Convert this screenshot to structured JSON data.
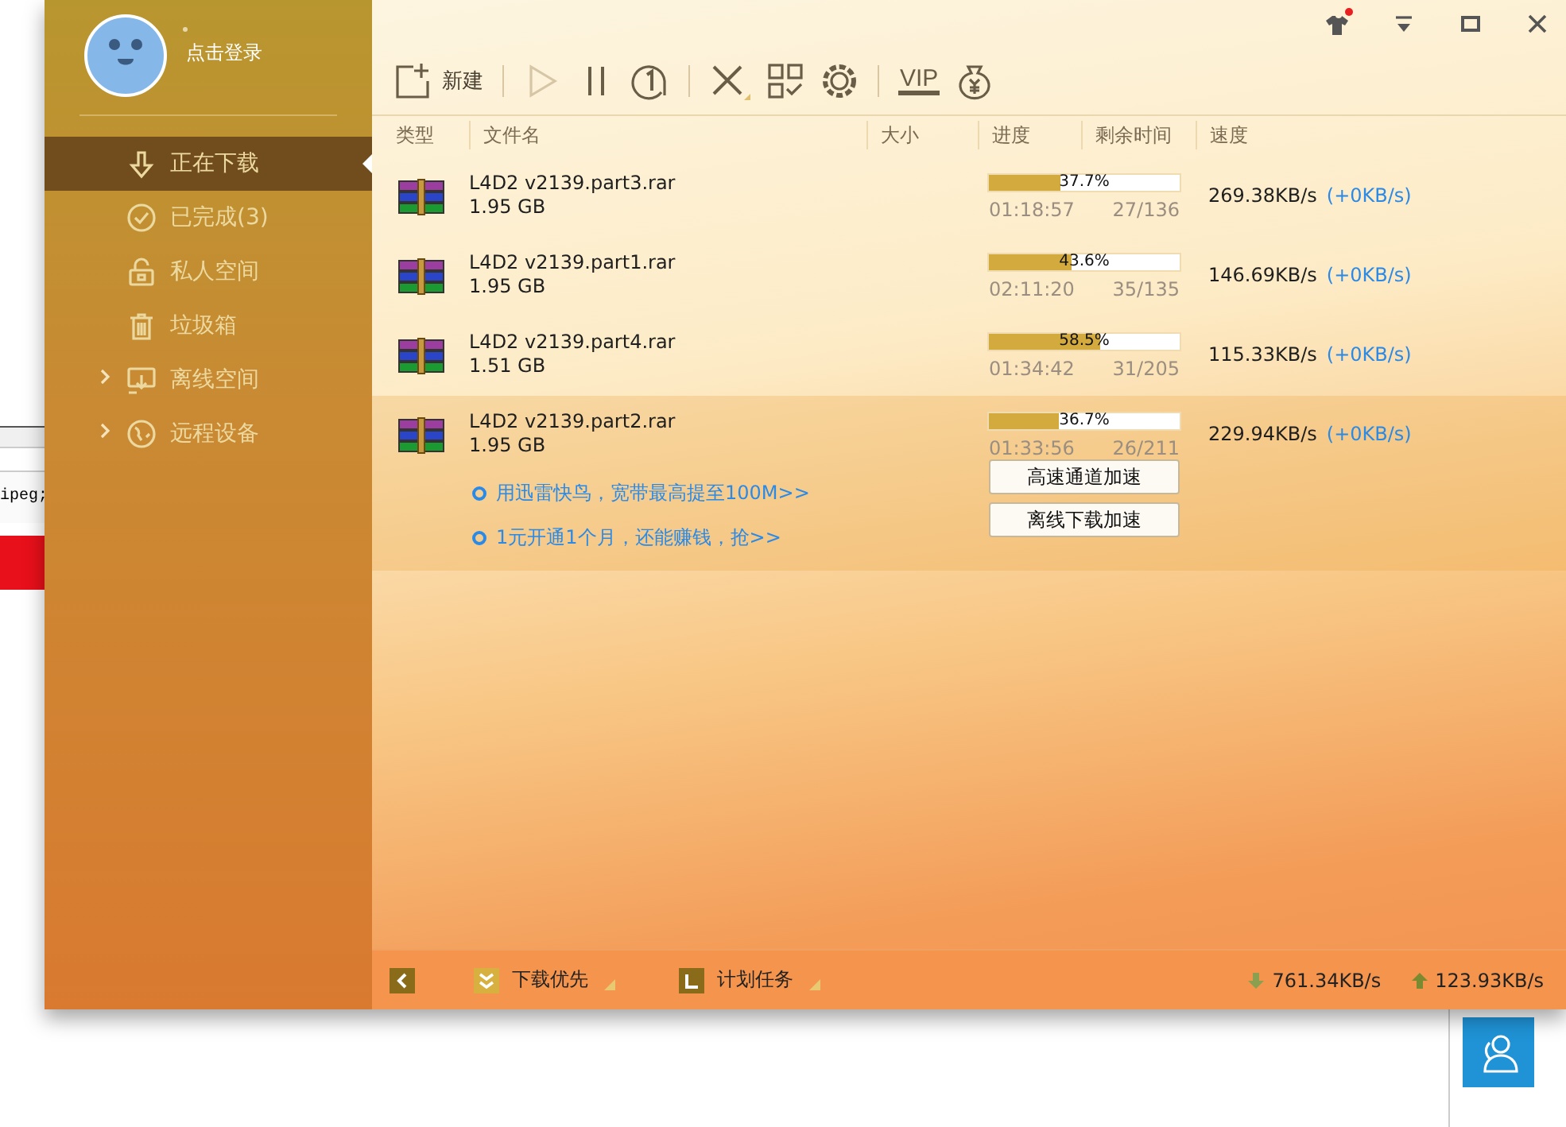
{
  "background": {
    "fragment_text": "ipeg;"
  },
  "sidebar": {
    "login_label": "点击登录",
    "items": [
      {
        "label": "正在下载",
        "selected": true,
        "kind": "plain"
      },
      {
        "label": "已完成(3)",
        "selected": false,
        "kind": "plain"
      },
      {
        "label": "私人空间",
        "selected": false,
        "kind": "plain"
      },
      {
        "label": "垃圾箱",
        "selected": false,
        "kind": "plain"
      },
      {
        "label": "离线空间",
        "selected": false,
        "kind": "expandable"
      },
      {
        "label": "远程设备",
        "selected": false,
        "kind": "expandable"
      }
    ]
  },
  "toolbar": {
    "groups": [
      [
        {
          "kind": "new",
          "label": "新建",
          "disabled": false
        }
      ],
      [
        {
          "kind": "start",
          "disabled": true
        },
        {
          "kind": "pause",
          "disabled": false
        },
        {
          "kind": "limit",
          "disabled": false
        }
      ],
      [
        {
          "kind": "delete",
          "disabled": false
        },
        {
          "kind": "qr",
          "disabled": false
        },
        {
          "kind": "settings",
          "disabled": false
        }
      ],
      [
        {
          "kind": "vip",
          "label": "VIP",
          "disabled": false
        },
        {
          "kind": "money",
          "disabled": false
        }
      ]
    ]
  },
  "table": {
    "columns": [
      "类型",
      "文件名",
      "大小",
      "进度",
      "剩余时间",
      "速度"
    ],
    "rows": [
      {
        "name": "L4D2 v2139.part3.rar",
        "size": "1.95 GB",
        "level": 0.377,
        "percent": "37.7%",
        "time_left": "01:18:57",
        "pieces": "27/136",
        "speed": "269.38KB/s",
        "boost": "(+0KB/s)",
        "expanded": false
      },
      {
        "name": "L4D2 v2139.part1.rar",
        "size": "1.95 GB",
        "level": 0.436,
        "percent": "43.6%",
        "time_left": "02:11:20",
        "pieces": "35/135",
        "speed": "146.69KB/s",
        "boost": "(+0KB/s)",
        "expanded": false
      },
      {
        "name": "L4D2 v2139.part4.rar",
        "size": "1.51 GB",
        "level": 0.585,
        "percent": "58.5%",
        "time_left": "01:34:42",
        "pieces": "31/205",
        "speed": "115.33KB/s",
        "boost": "(+0KB/s)",
        "expanded": false
      },
      {
        "name": "L4D2 v2139.part2.rar",
        "size": "1.95 GB",
        "level": 0.367,
        "percent": "36.7%",
        "time_left": "01:33:56",
        "pieces": "26/211",
        "speed": "229.94KB/s",
        "boost": "(+0KB/s)",
        "expanded": true,
        "promos": [
          "用迅雷快鸟，宽带最高提至100M>>",
          "1元开通1个月，还能赚钱，抢>>"
        ],
        "buttons": [
          "高速通道加速",
          "离线下载加速"
        ]
      }
    ]
  },
  "status_bar": {
    "items": [
      {
        "label": "下载优先"
      },
      {
        "label": "计划任务"
      }
    ],
    "download_speed": "761.34KB/s",
    "upload_speed": "123.93KB/s"
  }
}
